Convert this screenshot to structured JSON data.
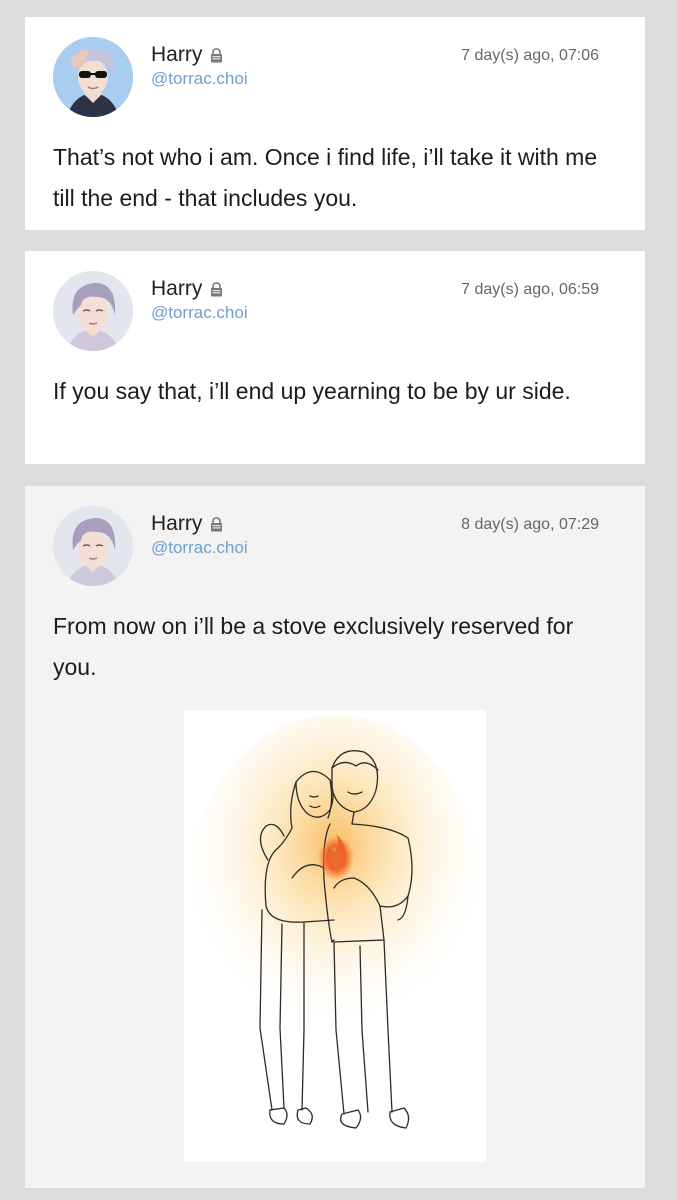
{
  "posts": [
    {
      "author": "Harry",
      "handle": "@torrac.choi",
      "time": "7 day(s) ago, 07:06",
      "text": "That’s not who i am. Once i find life, i’ll take it with me till the end - that includes you.",
      "avatar_icon": "avatar-sunglasses-icon"
    },
    {
      "author": "Harry",
      "handle": "@torrac.choi",
      "time": "7 day(s) ago, 06:59",
      "text": "If you say that, i’ll end up yearning to be by ur side.",
      "avatar_icon": "avatar-portrait-icon"
    },
    {
      "author": "Harry",
      "handle": "@torrac.choi",
      "time": "8 day(s) ago, 07:29",
      "text": "From now on i’ll be a stove exclusively reserved for you.",
      "avatar_icon": "avatar-portrait-icon",
      "image_icon": "embracing-couple-illustration"
    }
  ],
  "colors": {
    "page_background": "#dcdcdc",
    "card_background": "#ffffff",
    "highlight_card_background": "#f3f3f3",
    "handle_color": "#6f9fd0",
    "glow_color": "#f7c66a",
    "heart_color": "#e8602a"
  }
}
